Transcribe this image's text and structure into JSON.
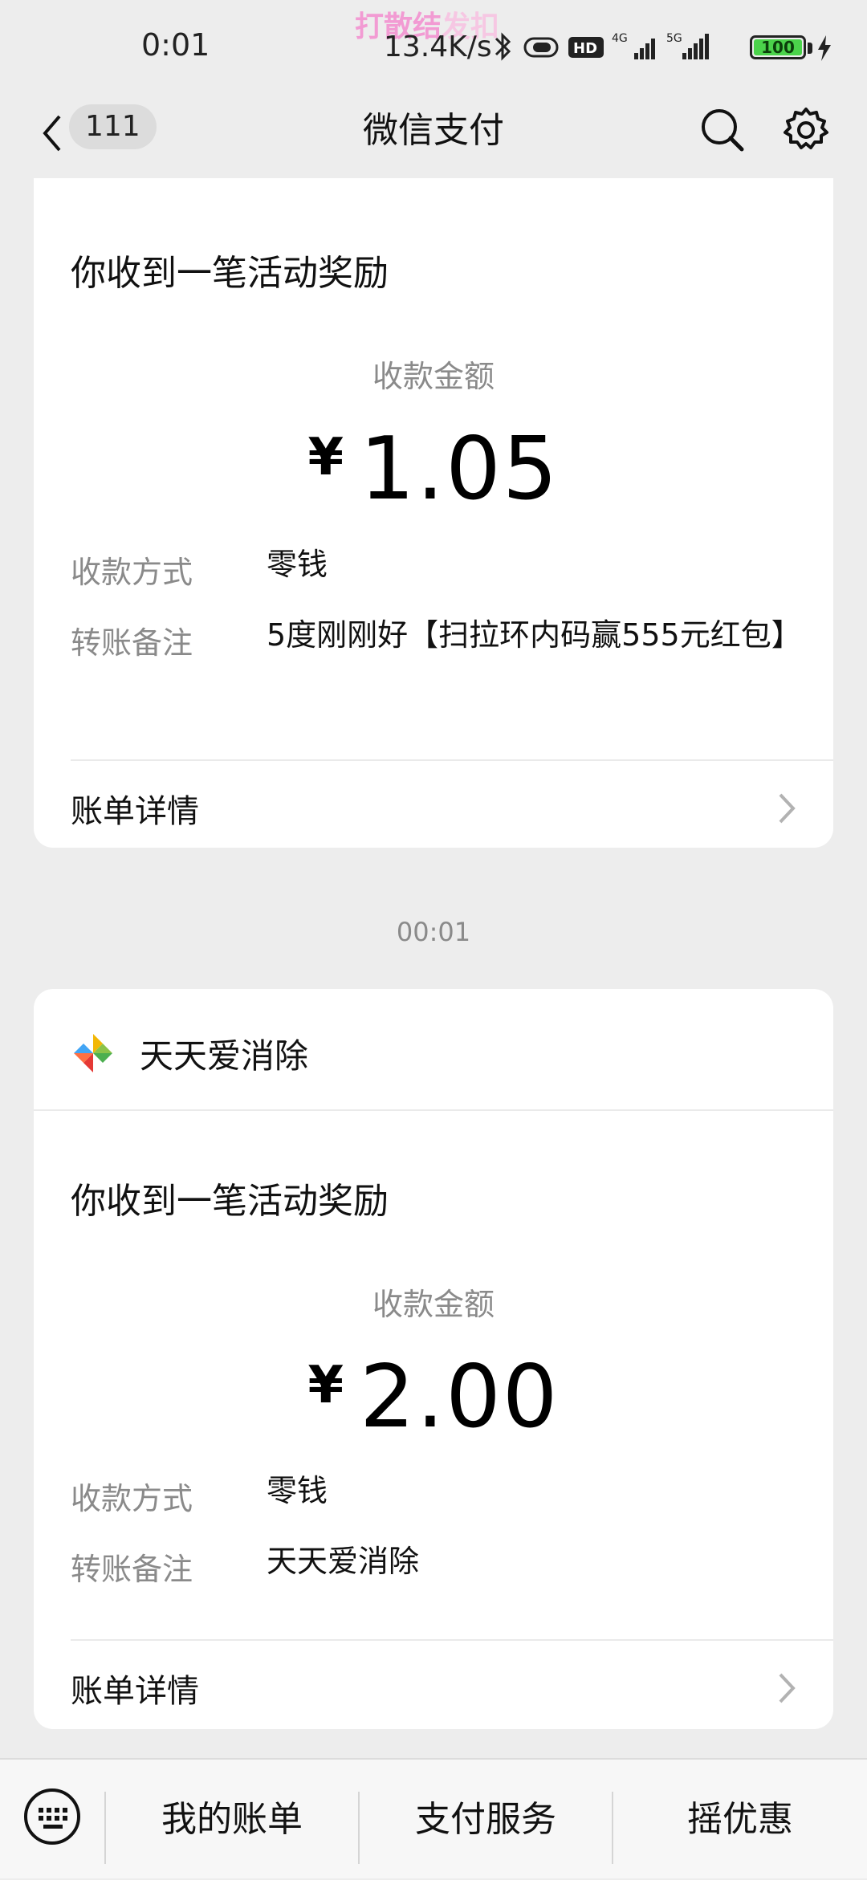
{
  "status_bar": {
    "time": "0:01",
    "overlay_part1": "打散结",
    "overlay_part2": "发扣",
    "speed": "13.4K/s",
    "battery": "100"
  },
  "nav": {
    "badge": "111",
    "title": "微信支付"
  },
  "cards": [
    {
      "title": "你收到一笔活动奖励",
      "amount_label": "收款金额",
      "currency": "¥",
      "amount": "1.05",
      "method_label": "收款方式",
      "method_value": "零钱",
      "note_label": "转账备注",
      "note_value": "5度刚刚好【扫拉环内码赢555元红包】",
      "detail_label": "账单详情"
    },
    {
      "brand": "天天爱消除",
      "title": "你收到一笔活动奖励",
      "amount_label": "收款金额",
      "currency": "¥",
      "amount": "2.00",
      "method_label": "收款方式",
      "method_value": "零钱",
      "note_label": "转账备注",
      "note_value": "天天爱消除",
      "detail_label": "账单详情"
    }
  ],
  "timestamp": "00:01",
  "bottom_bar": {
    "items": [
      "我的账单",
      "支付服务",
      "摇优惠"
    ]
  },
  "colors": {
    "background": "#ededed",
    "card": "#ffffff",
    "secondary_text": "#8a8a8a"
  }
}
